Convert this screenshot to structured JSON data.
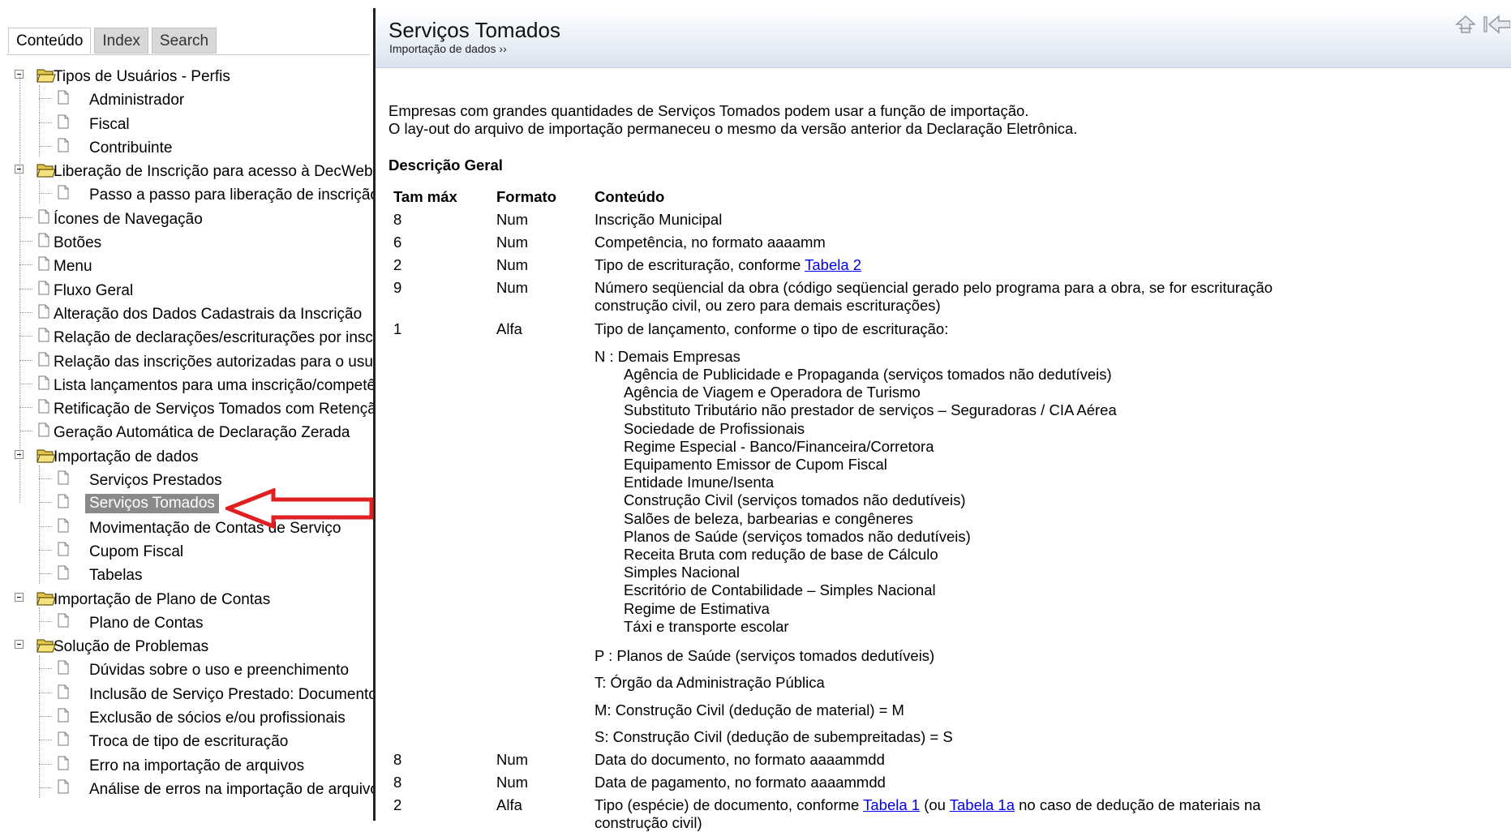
{
  "tabs": [
    {
      "label": "Conteúdo",
      "active": true
    },
    {
      "label": "Index",
      "active": false
    },
    {
      "label": "Search",
      "active": false
    }
  ],
  "toc": {
    "items": [
      {
        "level": 0,
        "type": "folder",
        "label": "Tipos de Usuários - Perfis"
      },
      {
        "level": 1,
        "type": "page",
        "label": "Administrador"
      },
      {
        "level": 1,
        "type": "page",
        "label": "Fiscal"
      },
      {
        "level": 1,
        "type": "page",
        "label": "Contribuinte"
      },
      {
        "level": 0,
        "type": "folder",
        "label": "Liberação de Inscrição para acesso à DecWeb"
      },
      {
        "level": 1,
        "type": "page",
        "label": "Passo a passo para liberação de inscrição"
      },
      {
        "level": 0,
        "type": "page",
        "label": "Ícones de Navegação"
      },
      {
        "level": 0,
        "type": "page",
        "label": "Botões"
      },
      {
        "level": 0,
        "type": "page",
        "label": "Menu"
      },
      {
        "level": 0,
        "type": "page",
        "label": "Fluxo Geral"
      },
      {
        "level": 0,
        "type": "page",
        "label": "Alteração dos Dados Cadastrais da Inscrição"
      },
      {
        "level": 0,
        "type": "page",
        "label": "Relação de declarações/escriturações por inscrição"
      },
      {
        "level": 0,
        "type": "page",
        "label": "Relação das inscrições autorizadas para o usuário"
      },
      {
        "level": 0,
        "type": "page",
        "label": "Lista lançamentos para uma inscrição/competência"
      },
      {
        "level": 0,
        "type": "page",
        "label": "Retificação de Serviços Tomados com Retenção"
      },
      {
        "level": 0,
        "type": "page",
        "label": "Geração Automática de Declaração Zerada"
      },
      {
        "level": 0,
        "type": "folder",
        "label": "Importação de dados"
      },
      {
        "level": 1,
        "type": "page",
        "label": "Serviços Prestados"
      },
      {
        "level": 1,
        "type": "page",
        "label": "Serviços Tomados",
        "selected": true
      },
      {
        "level": 1,
        "type": "page",
        "label": "Movimentação de Contas de Serviço"
      },
      {
        "level": 1,
        "type": "page",
        "label": "Cupom Fiscal"
      },
      {
        "level": 1,
        "type": "page",
        "label": "Tabelas"
      },
      {
        "level": 0,
        "type": "folder",
        "label": "Importação de Plano de Contas"
      },
      {
        "level": 1,
        "type": "page",
        "label": "Plano de Contas"
      },
      {
        "level": 0,
        "type": "folder",
        "label": "Solução de Problemas"
      },
      {
        "level": 1,
        "type": "page",
        "label": "Dúvidas sobre o uso e preenchimento"
      },
      {
        "level": 1,
        "type": "page",
        "label": "Inclusão de Serviço Prestado: Documento"
      },
      {
        "level": 1,
        "type": "page",
        "label": "Exclusão de sócios e/ou profissionais"
      },
      {
        "level": 1,
        "type": "page",
        "label": "Troca de tipo de escrituração"
      },
      {
        "level": 1,
        "type": "page",
        "label": "Erro na importação de arquivos"
      },
      {
        "level": 1,
        "type": "page",
        "label": "Análise de erros na importação de arquivos"
      }
    ]
  },
  "header": {
    "title": "Serviços Tomados",
    "breadcrumb": "Importação de dados ››"
  },
  "content": {
    "intro1": "Empresas com grandes quantidades de Serviços Tomados podem usar a função de importação.",
    "intro2": "O lay-out do arquivo de importação permaneceu o mesmo da versão anterior da Declaração Eletrônica.",
    "section_title": "Descrição Geral",
    "columns": [
      "Tam máx",
      "Formato",
      "Conteúdo"
    ],
    "rows": [
      {
        "tam": "8",
        "fmt": "Num",
        "text": "Inscrição Municipal"
      },
      {
        "tam": "6",
        "fmt": "Num",
        "text": "Competência, no formato aaaamm"
      },
      {
        "tam": "2",
        "fmt": "Num",
        "text": "Tipo de escrituração, conforme ",
        "link": "Tabela 2"
      },
      {
        "tam": "9",
        "fmt": "Num",
        "text": "Número seqüencial da obra (código seqüencial gerado pelo programa para a obra, se for escrituração",
        "text2": "construção civil, ou zero para demais escriturações)"
      },
      {
        "tam": "1",
        "fmt": "Alfa",
        "text": "Tipo de lançamento, conforme o tipo de escrituração:"
      }
    ],
    "code_n": "N :  Demais Empresas",
    "n_items": [
      "Agência de Publicidade e Propaganda (serviços tomados não dedutíveis)",
      "Agência de Viagem e Operadora de Turismo",
      "Substituto Tributário não prestador de serviços – Seguradoras / CIA Aérea",
      "Sociedade de Profissionais",
      "Regime Especial - Banco/Financeira/Corretora",
      "Equipamento Emissor de Cupom Fiscal",
      "Entidade Imune/Isenta",
      "Construção Civil (serviços tomados não dedutíveis)",
      "Salões de beleza, barbearias e congêneres",
      "Planos de Saúde (serviços tomados não dedutíveis)",
      "Receita Bruta com redução de base de Cálculo",
      "Simples Nacional",
      "Escritório de Contabilidade – Simples Nacional",
      "Regime de Estimativa",
      "Táxi e transporte escolar"
    ],
    "code_p": "P :  Planos de Saúde (serviços tomados dedutíveis)",
    "code_t": "T:   Órgão da Administração Pública",
    "code_m": "M:  Construção Civil (dedução de material) = M",
    "code_s": "S:  Construção Civil (dedução de subempreitadas) = S",
    "rows2": [
      {
        "tam": "8",
        "fmt": "Num",
        "text": "Data do documento, no formato aaaammdd"
      },
      {
        "tam": "8",
        "fmt": "Num",
        "text": "Data de pagamento, no formato aaaammdd"
      },
      {
        "tam": "2",
        "fmt": "Alfa",
        "text": "Tipo (espécie) de documento, conforme ",
        "link": "Tabela 1",
        "mid": " (ou ",
        "link2": "Tabela 1a",
        "tail": " no caso de dedução de materiais na",
        "text2": "construção civil)"
      }
    ]
  },
  "colors": {
    "selection": "#8a8a8a",
    "link": "#0000ee",
    "header_gradient_end": "#d9e3ef",
    "arrow": "#e02020"
  }
}
